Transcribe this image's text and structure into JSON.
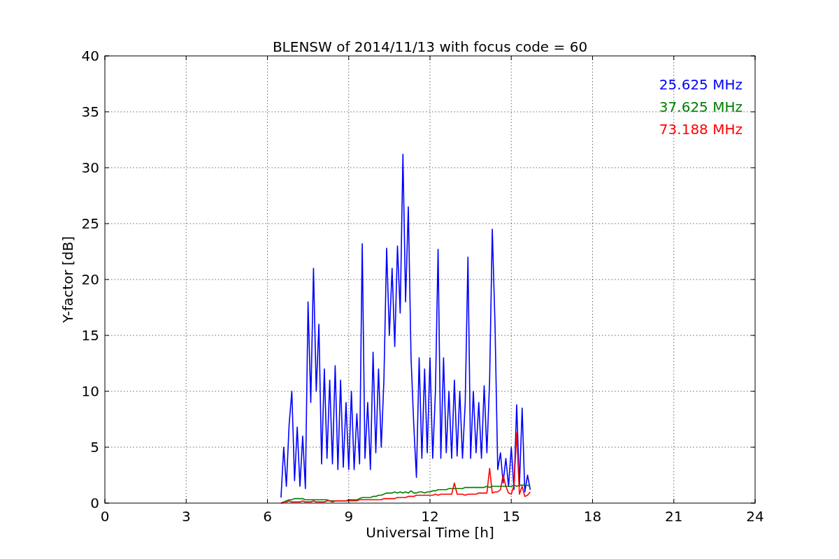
{
  "chart_data": {
    "type": "line",
    "title": "BLENSW of 2014/11/13 with focus code = 60",
    "xlabel": "Universal Time [h]",
    "ylabel": "Y-factor [dB]",
    "xlim": [
      0,
      24
    ],
    "ylim": [
      0,
      40
    ],
    "xticks": [
      0,
      3,
      6,
      9,
      12,
      15,
      18,
      21,
      24
    ],
    "yticks": [
      0,
      5,
      10,
      15,
      20,
      25,
      30,
      35,
      40
    ],
    "grid": true,
    "x": [
      6.5,
      6.6,
      6.7,
      6.8,
      6.9,
      7.0,
      7.1,
      7.2,
      7.3,
      7.4,
      7.5,
      7.6,
      7.7,
      7.8,
      7.9,
      8.0,
      8.1,
      8.2,
      8.3,
      8.4,
      8.5,
      8.6,
      8.7,
      8.8,
      8.9,
      9.0,
      9.1,
      9.2,
      9.3,
      9.4,
      9.5,
      9.6,
      9.7,
      9.8,
      9.9,
      10.0,
      10.1,
      10.2,
      10.3,
      10.4,
      10.5,
      10.6,
      10.7,
      10.8,
      10.9,
      11.0,
      11.1,
      11.2,
      11.3,
      11.4,
      11.5,
      11.6,
      11.7,
      11.8,
      11.9,
      12.0,
      12.1,
      12.2,
      12.3,
      12.4,
      12.5,
      12.6,
      12.7,
      12.8,
      12.9,
      13.0,
      13.1,
      13.2,
      13.3,
      13.4,
      13.5,
      13.6,
      13.7,
      13.8,
      13.9,
      14.0,
      14.1,
      14.2,
      14.3,
      14.4,
      14.5,
      14.6,
      14.7,
      14.8,
      14.9,
      15.0,
      15.1,
      15.2,
      15.3,
      15.4,
      15.5,
      15.6,
      15.7
    ],
    "series": [
      {
        "name": "25.625 MHz",
        "color": "#0000ff",
        "values": [
          0.5,
          5,
          1.5,
          7,
          10,
          2,
          6.8,
          1.5,
          6,
          1.3,
          18,
          9,
          21,
          10,
          16,
          3.5,
          12,
          4,
          11,
          3.5,
          12.3,
          3,
          11,
          3.2,
          9,
          3,
          10,
          3,
          8,
          3.5,
          23.2,
          4,
          9,
          3,
          13.5,
          4.5,
          12,
          5,
          11,
          22.8,
          15,
          21,
          14,
          23,
          17,
          31.2,
          18,
          26.5,
          13,
          7,
          2.3,
          13,
          4,
          12,
          4.5,
          13,
          4,
          10,
          22.7,
          4,
          13,
          4.5,
          10,
          4,
          11,
          4.2,
          10,
          4,
          9,
          22,
          4,
          10,
          4.5,
          9,
          4,
          10.5,
          4.5,
          11,
          24.5,
          16,
          3,
          4.5,
          1.8,
          4,
          1.5,
          5,
          1.2,
          8.8,
          1.5,
          8.5,
          1,
          2.5,
          1.2
        ]
      },
      {
        "name": "37.625 MHz",
        "color": "#008000",
        "values": [
          0,
          0.1,
          0.2,
          0.3,
          0.3,
          0.4,
          0.4,
          0.4,
          0.4,
          0.3,
          0.3,
          0.3,
          0.3,
          0.3,
          0.3,
          0.3,
          0.3,
          0.3,
          0.2,
          0.2,
          0.2,
          0.2,
          0.2,
          0.2,
          0.2,
          0.3,
          0.3,
          0.3,
          0.3,
          0.4,
          0.5,
          0.5,
          0.5,
          0.5,
          0.6,
          0.6,
          0.7,
          0.7,
          0.8,
          0.9,
          0.9,
          0.9,
          1,
          0.9,
          1,
          0.9,
          1,
          0.9,
          1.1,
          0.9,
          0.9,
          1,
          1,
          0.9,
          1,
          1,
          1.1,
          1.1,
          1.2,
          1.2,
          1.2,
          1.2,
          1.3,
          1.3,
          1.3,
          1.3,
          1.3,
          1.3,
          1.4,
          1.4,
          1.4,
          1.4,
          1.4,
          1.4,
          1.4,
          1.4,
          1.5,
          1.4,
          1.5,
          1.5,
          1.5,
          1.5,
          1.5,
          1.5,
          1.5,
          1.5,
          1.6,
          1.5,
          1.6,
          1.6,
          1.6,
          1.6,
          1.5
        ]
      },
      {
        "name": "73.188 MHz",
        "color": "#ff0000",
        "values": [
          0,
          0.1,
          0.1,
          0.2,
          0.1,
          0.1,
          0.1,
          0.1,
          0.2,
          0.1,
          0.1,
          0.1,
          0.2,
          0.1,
          0.1,
          0.1,
          0.1,
          0.2,
          0.2,
          0.1,
          0.2,
          0.2,
          0.2,
          0.2,
          0.2,
          0.2,
          0.2,
          0.2,
          0.2,
          0.3,
          0.3,
          0.3,
          0.3,
          0.3,
          0.3,
          0.3,
          0.3,
          0.3,
          0.4,
          0.4,
          0.4,
          0.4,
          0.4,
          0.5,
          0.5,
          0.5,
          0.5,
          0.6,
          0.6,
          0.6,
          0.7,
          0.7,
          0.7,
          0.7,
          0.7,
          0.7,
          0.7,
          0.8,
          0.7,
          0.8,
          0.8,
          0.8,
          0.8,
          0.8,
          1.8,
          0.8,
          0.8,
          0.8,
          0.7,
          0.8,
          0.8,
          0.8,
          0.8,
          0.9,
          0.9,
          0.9,
          0.9,
          3.1,
          0.9,
          1,
          1,
          1.2,
          2.5,
          1.5,
          0.9,
          0.8,
          1.6,
          6.3,
          0.8,
          1.5,
          0.6,
          0.7,
          1
        ]
      }
    ]
  }
}
